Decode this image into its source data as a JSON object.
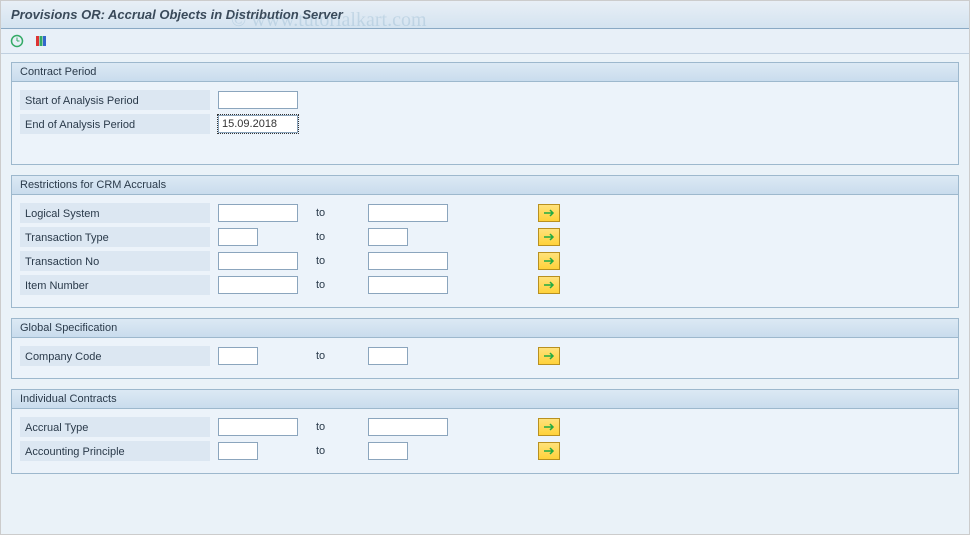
{
  "title": "Provisions OR: Accrual Objects in Distribution Server",
  "watermark": "© www.tutorialkart.com",
  "groups": {
    "contract": {
      "title": "Contract Period",
      "start_label": "Start of Analysis Period",
      "start_value": "",
      "end_label": "End of Analysis Period",
      "end_value": "15.09.2018"
    },
    "restrictions": {
      "title": "Restrictions for CRM Accruals",
      "to_label": "to",
      "rows": {
        "logical_system": {
          "label": "Logical System",
          "from": "",
          "to": ""
        },
        "transaction_type": {
          "label": "Transaction Type",
          "from": "",
          "to": ""
        },
        "transaction_no": {
          "label": "Transaction No",
          "from": "",
          "to": ""
        },
        "item_number": {
          "label": "Item Number",
          "from": "",
          "to": ""
        }
      }
    },
    "global": {
      "title": "Global Specification",
      "to_label": "to",
      "company_code": {
        "label": "Company Code",
        "from": "",
        "to": ""
      }
    },
    "individual": {
      "title": "Individual Contracts",
      "to_label": "to",
      "accrual_type": {
        "label": "Accrual Type",
        "from": "",
        "to": ""
      },
      "accounting_principle": {
        "label": "Accounting Principle",
        "from": "",
        "to": ""
      }
    }
  }
}
